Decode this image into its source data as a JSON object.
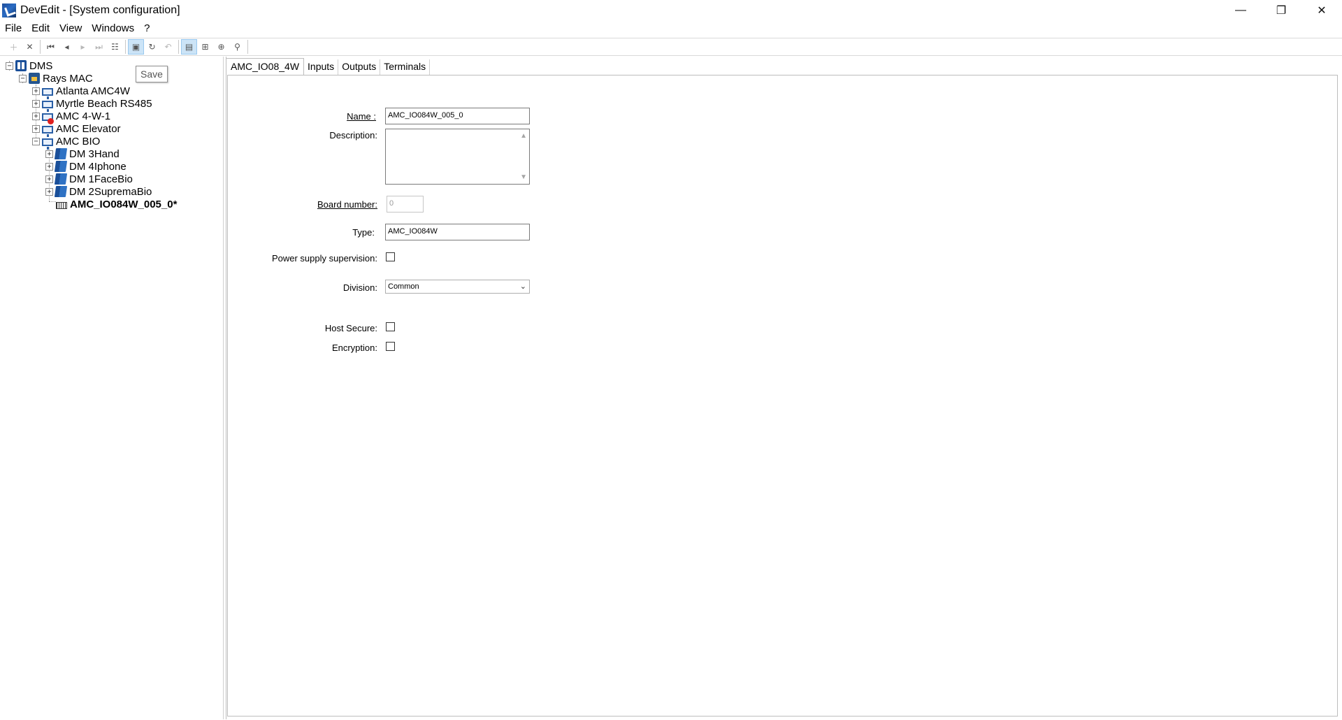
{
  "window": {
    "title": "DevEdit - [System configuration]",
    "minimize": "—",
    "restore": "❐",
    "close": "✕"
  },
  "menu": [
    "File",
    "Edit",
    "View",
    "Windows",
    "?"
  ],
  "tooltip": {
    "text": "Save"
  },
  "tree": {
    "root": "DMS",
    "mac": "Rays MAC",
    "items": [
      "Atlanta AMC4W",
      "Myrtle Beach RS485",
      "AMC 4-W-1",
      "AMC Elevator",
      "AMC BIO"
    ],
    "bio_children": [
      "DM 3Hand",
      "DM 4Iphone",
      "DM 1FaceBio",
      "DM 2SupremaBio"
    ],
    "selected": "AMC_IO084W_005_0*"
  },
  "tabs": [
    "AMC_IO08_4W",
    "Inputs",
    "Outputs",
    "Terminals"
  ],
  "form": {
    "name_label": "Name :",
    "name_value": "AMC_IO084W_005_0",
    "description_label": "Description:",
    "board_label": "Board number:",
    "board_value": "0",
    "type_label": "Type:",
    "type_value": "AMC_IO084W",
    "power_label": "Power supply supervision:",
    "division_label": "Division:",
    "division_value": "Common",
    "host_secure_label": "Host Secure:",
    "encryption_label": "Encryption:"
  }
}
